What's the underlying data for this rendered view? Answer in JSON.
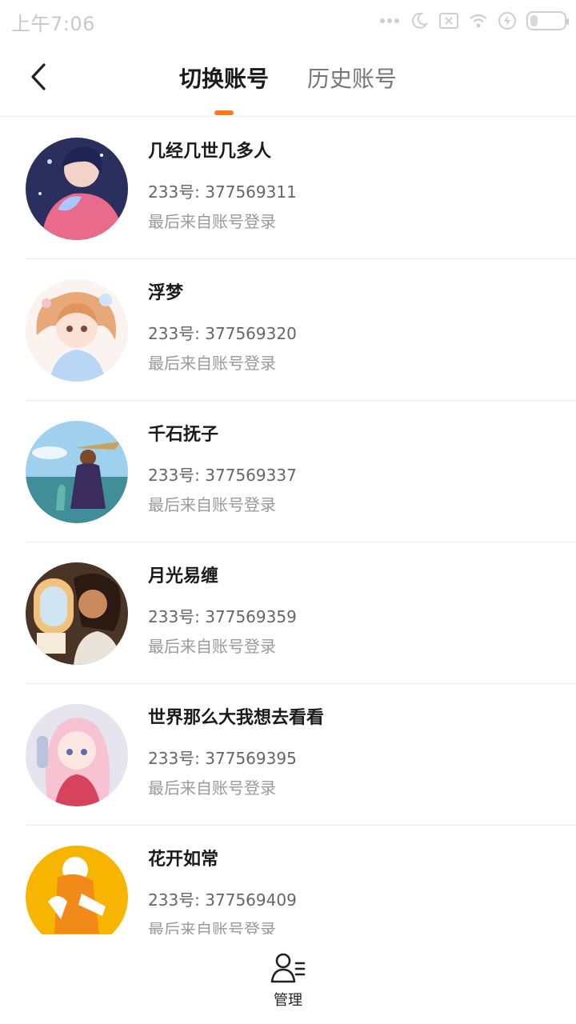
{
  "status_bar": {
    "time": "上午7:06",
    "battery": "21",
    "battery_level_percent": 21,
    "icons": [
      "dots-icon",
      "moon-icon",
      "sim-off-icon",
      "wifi-icon",
      "charging-icon",
      "battery-icon"
    ]
  },
  "header": {
    "back_icon": "chevron-left-icon",
    "tabs": [
      {
        "label": "切换账号",
        "active": true
      },
      {
        "label": "历史账号",
        "active": false
      }
    ],
    "accent_color": "#ff7a1a"
  },
  "accounts": [
    {
      "name": "几经几世几多人",
      "id": "233号: 377569311",
      "login": "最后来自账号登录"
    },
    {
      "name": "浮梦",
      "id": "233号: 377569320",
      "login": "最后来自账号登录"
    },
    {
      "name": "千石抚子",
      "id": "233号: 377569337",
      "login": "最后来自账号登录"
    },
    {
      "name": "月光易缠",
      "id": "233号: 377569359",
      "login": "最后来自账号登录"
    },
    {
      "name": "世界那么大我想去看看",
      "id": "233号: 377569395",
      "login": "最后来自账号登录"
    },
    {
      "name": "花开如常",
      "id": "233号: 377569409",
      "login": "最后来自账号登录"
    }
  ],
  "bottom_bar": {
    "manage_icon": "user-manage-icon",
    "manage_label": "管理"
  }
}
